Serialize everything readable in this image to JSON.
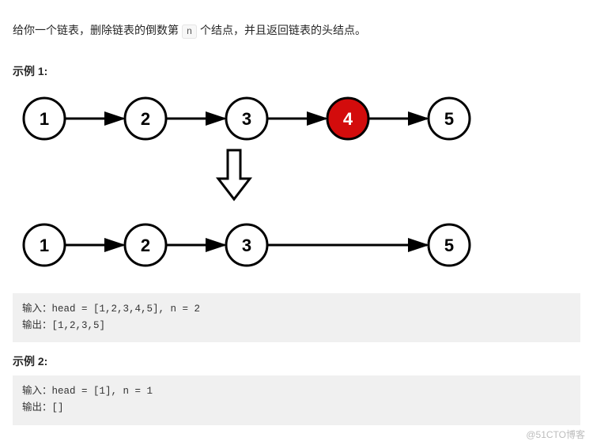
{
  "problem": {
    "desc_pre": "给你一个链表，删除链表的倒数第 ",
    "code_n": "n",
    "desc_post": " 个结点，并且返回链表的头结点。"
  },
  "example1": {
    "heading": "示例 1:",
    "nodes_top": [
      "1",
      "2",
      "3",
      "4",
      "5"
    ],
    "nodes_bottom": [
      "1",
      "2",
      "3",
      "5"
    ],
    "highlight_index": 3,
    "input_label": "输入：",
    "input_value": "head = [1,2,3,4,5], n = 2",
    "output_label": "输出：",
    "output_value": "[1,2,3,5]"
  },
  "example2": {
    "heading": "示例 2:",
    "input_label": "输入：",
    "input_value": "head = [1], n = 1",
    "output_label": "输出：",
    "output_value": "[]"
  },
  "watermark": "@51CTO博客"
}
